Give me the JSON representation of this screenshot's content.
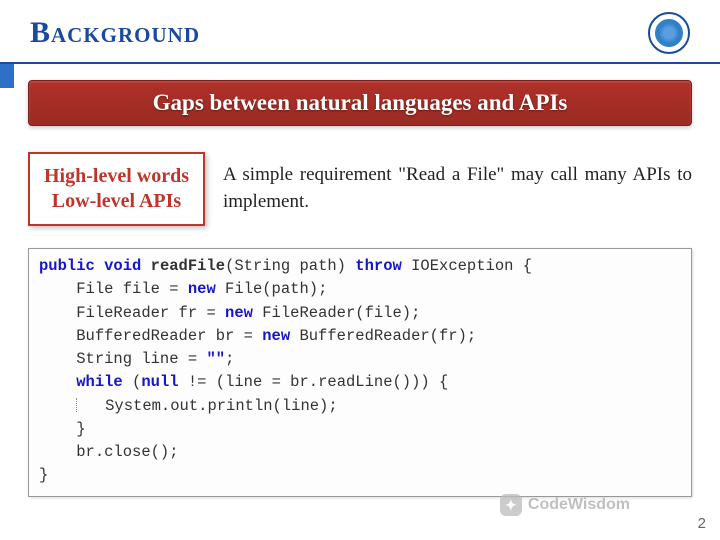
{
  "header": {
    "title": "Background"
  },
  "banner": "Gaps between natural languages and APIs",
  "box": {
    "line1": "High-level words",
    "line2": "Low-level APIs"
  },
  "desc": "A simple requirement \"Read a File\" may call many APIs to implement.",
  "code": {
    "sig_pre": "public void",
    "sig_name": "readFile",
    "sig_mid": "(String path) ",
    "sig_throw": "throw",
    "sig_post": " IOException {",
    "l2a": "File file = ",
    "l2n": "new",
    "l2b": " File(path);",
    "l3a": "FileReader fr = ",
    "l3n": "new",
    "l3b": " FileReader(file);",
    "l4a": "BufferedReader br = ",
    "l4n": "new",
    "l4b": " BufferedReader(fr);",
    "l5a": "String line = ",
    "l5s": "\"\"",
    "l5b": ";",
    "l6a": "while",
    "l6b": " (",
    "l6c": "null",
    "l6d": " != (line = br.readLine())) {",
    "l7": "System.out.println(line);",
    "l8": "}",
    "l9": "br.close();",
    "l10": "}"
  },
  "watermark": "CodeWisdom",
  "page_number": "2"
}
